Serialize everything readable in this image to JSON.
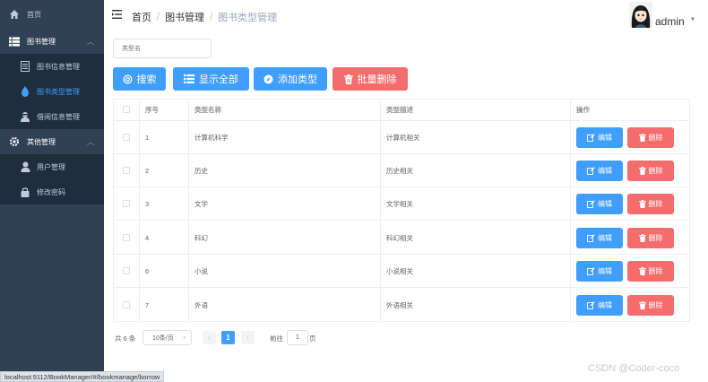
{
  "sidebar": {
    "home": "首页",
    "book_mgmt": "图书管理",
    "book_info": "图书信息管理",
    "book_type": "图书类型管理",
    "borrow_info": "借阅信息管理",
    "other_mgmt": "其他管理",
    "user_mgmt": "用户管理",
    "change_pwd": "修改密码"
  },
  "header": {
    "breadcrumb": [
      "首页",
      "图书管理",
      "图书类型管理"
    ],
    "user": "admin"
  },
  "search": {
    "placeholder": "类型名"
  },
  "toolbar": {
    "search_label": "搜索",
    "show_all_label": "显示全部",
    "add_label": "添加类型",
    "batch_delete_label": "批量删除"
  },
  "table": {
    "headers": [
      "序号",
      "类型名称",
      "类型描述",
      "操作"
    ],
    "rows": [
      {
        "id": "1",
        "name": "计算机科学",
        "desc": "计算机相关"
      },
      {
        "id": "2",
        "name": "历史",
        "desc": "历史相关"
      },
      {
        "id": "3",
        "name": "文学",
        "desc": "文学相关"
      },
      {
        "id": "4",
        "name": "科幻",
        "desc": "科幻相关"
      },
      {
        "id": "6",
        "name": "小说",
        "desc": "小说相关"
      },
      {
        "id": "7",
        "name": "外语",
        "desc": "外语相关"
      }
    ],
    "edit_label": "编辑",
    "delete_label": "删除"
  },
  "pagination": {
    "total": "共 6 条",
    "page_size": "10条/页",
    "current_page": "1",
    "goto_label": "前往",
    "goto_value": "1",
    "page_suffix": "页"
  },
  "status_url": "localhost:9112/BookManager/#/bookmanage/borrow",
  "watermark": "CSDN @Coder-coco",
  "colors": {
    "sidebar": "#304156",
    "submenu": "#1f2d3d",
    "primary": "#409eff",
    "danger": "#f56c6c"
  }
}
